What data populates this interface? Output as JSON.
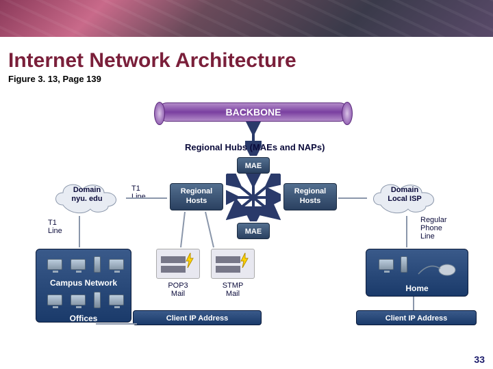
{
  "header": {
    "title": "Internet Network Architecture",
    "subtitle": "Figure 3. 13, Page 139"
  },
  "diagram": {
    "backbone": "BACKBONE",
    "regional_hubs_label": "Regional Hubs (MAEs and NAPs)",
    "mae_top": "MAE",
    "mae_bottom": "MAE",
    "regional_hosts_left": "Regional\nHosts",
    "regional_hosts_right": "Regional\nHosts",
    "cloud_domain_left": "Domain\nnyu. edu",
    "cloud_domain_right": "Domain\nLocal ISP",
    "t1_line_cloud": "T1\nLine",
    "t1_line_campus": "T1\nLine",
    "regular_phone_line": "Regular\nPhone\nLine",
    "campus_network": "Campus Network",
    "offices": "Offices",
    "home": "Home",
    "client_ip_left": "Client IP Address",
    "client_ip_right": "Client IP Address",
    "pop3": "POP3\nMail",
    "smtp": "STMP\nMail"
  },
  "page_number": "33"
}
